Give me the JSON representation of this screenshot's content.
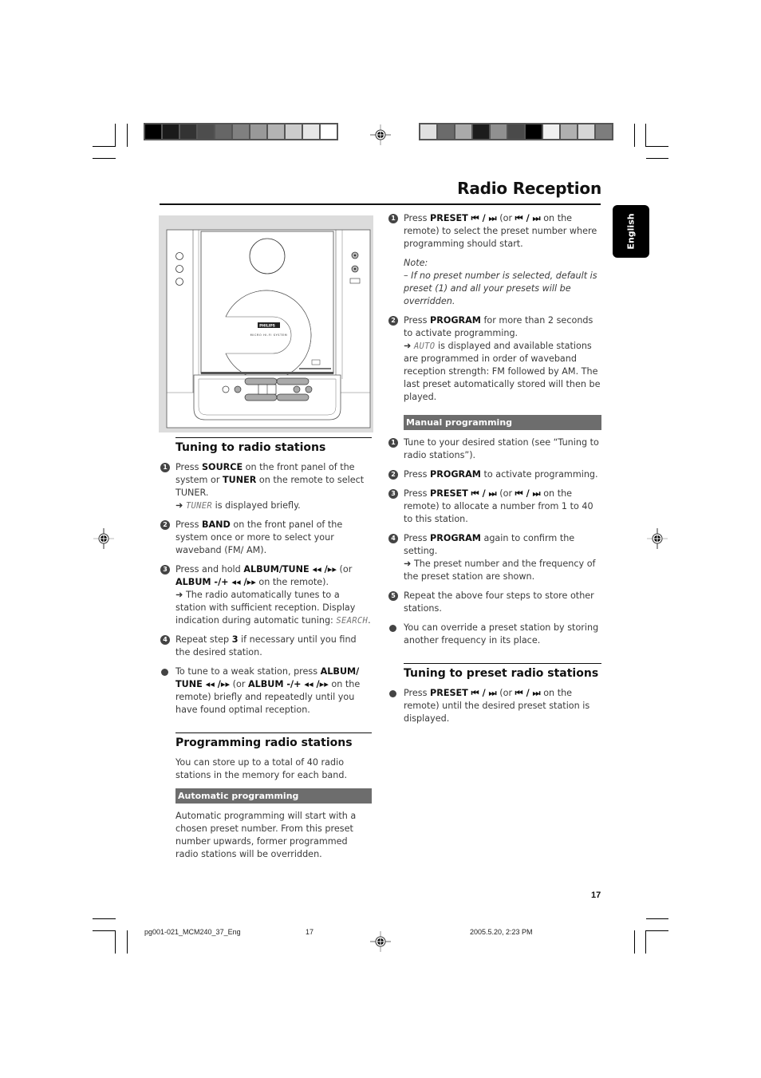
{
  "header": {
    "title": "Radio Reception",
    "language_tab": "English"
  },
  "colors": {
    "left_bar": [
      "#000000",
      "#1a1a1a",
      "#333333",
      "#4d4d4d",
      "#666666",
      "#808080",
      "#999999",
      "#b3b3b3",
      "#cccccc",
      "#e6e6e6",
      "#ffffff"
    ],
    "right_bar": [
      "#e0e0e0",
      "#6b6b6b",
      "#aaaaaa",
      "#1c1c1c",
      "#909090",
      "#4a4a4a",
      "#000000",
      "#f0f0f0",
      "#b0b0b0",
      "#d6d6d6",
      "#7d7d7d"
    ],
    "subheading_bg": "#6d6d6d",
    "device_bg": "#dcdcdc"
  },
  "device": {
    "brand": "PHILIPS",
    "model_text": "MICRO HI-FI SYSTEM",
    "icon": "stereo-system-illustration"
  },
  "left": {
    "tuning": {
      "heading": "Tuning to radio stations",
      "steps": [
        {
          "n": "1",
          "pre": "Press ",
          "b1": "SOURCE",
          "mid": " on the front panel of the system or ",
          "b2": "TUNER",
          "post": " on the remote to select TUNER.",
          "arrow": "➜ ",
          "lcd": "TUNER",
          "arrow_text": " is displayed briefly."
        },
        {
          "n": "2",
          "pre": "Press ",
          "b1": "BAND",
          "post": " on the front panel of the system once or more to select your waveband (FM/ AM)."
        },
        {
          "n": "3",
          "pre": "Press and hold ",
          "b1": "ALBUM/TUNE ◂◂ /▸▸",
          "mid": " (or ",
          "b2": "ALBUM -/+ ◂◂ /▸▸",
          "post": "  on the remote).",
          "arrow": "➜ ",
          "arrow_text": "The radio automatically tunes to a station with sufficient reception. Display indication during automatic tuning: ",
          "lcd": "SEARCH",
          "end": "."
        },
        {
          "n": "4",
          "pre": "Repeat step ",
          "b1": "3",
          "post": " if necessary until you find the desired station."
        }
      ],
      "bullet": {
        "pre": "To tune to a weak station, press ",
        "b1": "ALBUM/ TUNE ◂◂ /▸▸",
        "mid": " (or ",
        "b2": "ALBUM -/+ ◂◂ /▸▸",
        "post": "  on the remote) briefly and repeatedly until you have found optimal reception."
      }
    },
    "programming": {
      "heading": "Programming radio stations",
      "intro": "You can store up to a total of 40 radio stations in the memory for each band.",
      "auto_heading": "Automatic programming",
      "auto_text": "Automatic programming will start with a chosen preset number. From this preset number upwards, former programmed radio stations will be overridden."
    }
  },
  "right": {
    "auto_steps": [
      {
        "n": "1",
        "pre": "Press ",
        "b1": "PRESET ⏮ / ⏭",
        "mid": " (or  ",
        "b2": "⏮ / ⏭",
        "post": "  on the remote) to select the preset number where programming should start."
      },
      {
        "n": "2",
        "pre": "Press ",
        "b1": "PROGRAM",
        "post": " for more than 2 seconds to activate programming.",
        "arrow": "➜ ",
        "lcd": "AUTO",
        "arrow_text": " is displayed and available stations are programmed in order of waveband reception strength: FM followed by AM. The last preset automatically stored will then be played."
      }
    ],
    "note_label": "Note:",
    "note_text": "–  If no preset number is selected, default is preset (1) and all your presets will be overridden.",
    "manual_heading": "Manual programming",
    "manual_steps": [
      {
        "n": "1",
        "text": "Tune to your desired station (see “Tuning to radio stations”)."
      },
      {
        "n": "2",
        "pre": "Press ",
        "b1": "PROGRAM",
        "post": " to activate programming."
      },
      {
        "n": "3",
        "pre": "Press ",
        "b1": "PRESET ⏮ / ⏭",
        "mid": " (or  ",
        "b2": "⏮ / ⏭",
        "post": "  on the remote) to allocate a number from 1 to 40 to this station."
      },
      {
        "n": "4",
        "pre": "Press ",
        "b1": "PROGRAM",
        "post": " again to confirm the setting.",
        "arrow": "➜ ",
        "arrow_text": "The preset number and the frequency of the preset station are shown."
      },
      {
        "n": "5",
        "text": "Repeat the above four steps to store other stations."
      }
    ],
    "manual_bullet": "You can override a preset station by storing another frequency in its place.",
    "preset": {
      "heading": "Tuning to preset radio stations",
      "bullet": {
        "pre": "Press ",
        "b1": "PRESET ⏮ / ⏭",
        "mid": " (or  ",
        "b2": "⏮ / ⏭",
        "post": "  on the remote) until the desired preset station is displayed."
      }
    }
  },
  "page_number": "17",
  "footer": {
    "file": "pg001-021_MCM240_37_Eng",
    "page": "17",
    "timestamp": "2005.5.20, 2:23 PM"
  }
}
